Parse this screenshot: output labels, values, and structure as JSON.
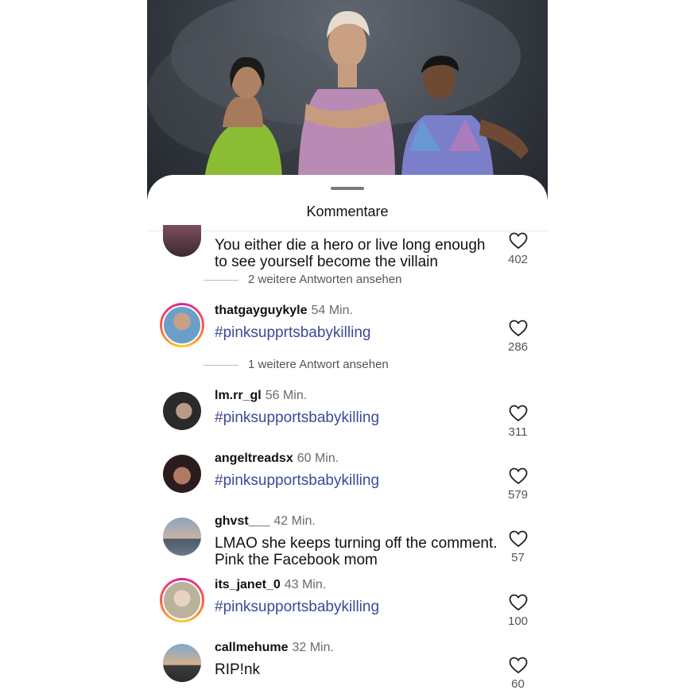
{
  "sheet": {
    "title": "Kommentare"
  },
  "comments": [
    {
      "user": "",
      "time": "",
      "text": "You either die a hero or live long enough to see yourself become the villain",
      "likes": "402",
      "replies": "2 weitere Antworten ansehen"
    },
    {
      "user": "thatgayguykyle",
      "time": "54 Min.",
      "text": "#pinksupprtsbabykilling",
      "likes": "286",
      "replies": "1 weitere Antwort ansehen"
    },
    {
      "user": "lm.rr_gl",
      "time": "56 Min.",
      "text": "#pinksupportsbabykilling",
      "likes": "311"
    },
    {
      "user": "angeltreadsx",
      "time": "60 Min.",
      "text": "#pinksupportsbabykilling",
      "likes": "579"
    },
    {
      "user": "ghvst___",
      "time": "42 Min.",
      "text": "LMAO she keeps turning off the comment. Pink the Facebook mom",
      "likes": "57"
    },
    {
      "user": "its_janet_0",
      "time": "43 Min.",
      "text": "#pinksupportsbabykilling",
      "likes": "100"
    },
    {
      "user": "callmehume",
      "time": "32 Min.",
      "text": "RIP!nk",
      "likes": "60"
    }
  ],
  "colors": {
    "hashtag": "#3a4a9a",
    "story_ring": "#d6249f"
  }
}
